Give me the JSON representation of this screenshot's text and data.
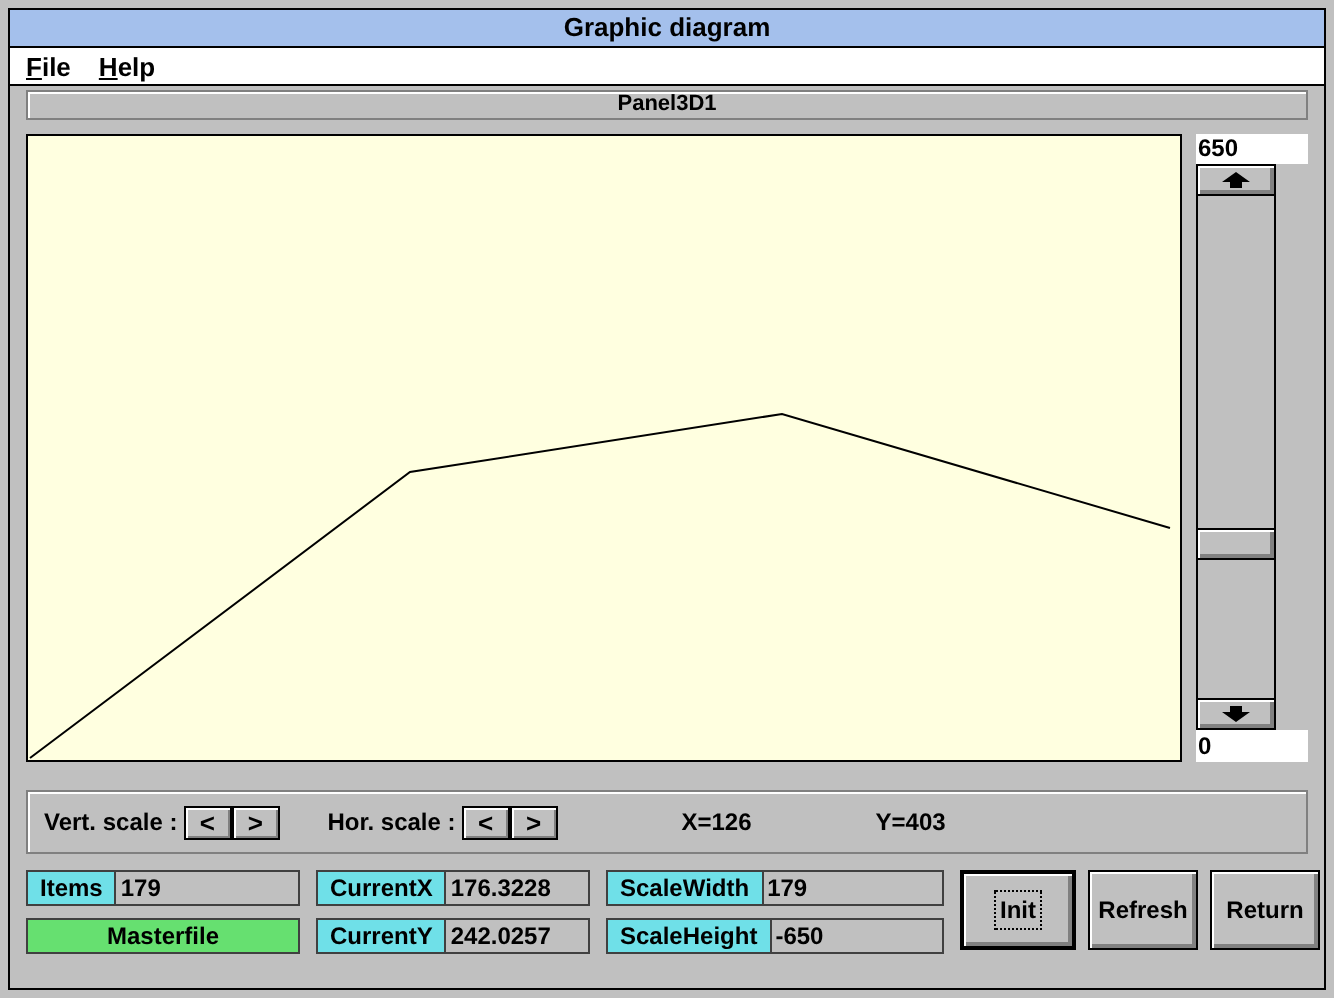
{
  "window": {
    "title": "Graphic diagram"
  },
  "menu": [
    {
      "label": "File"
    },
    {
      "label": "Help"
    }
  ],
  "panel": {
    "title": "Panel3D1"
  },
  "scale": {
    "max": "650",
    "min": "0"
  },
  "toolbar": {
    "vert_label": "Vert. scale :",
    "vert_buttons": [
      "<",
      ">"
    ],
    "hor_label": "Hor. scale :",
    "hor_buttons": [
      "<",
      ">"
    ],
    "x_readout": "X=126",
    "y_readout": "Y=403"
  },
  "fields": [
    {
      "kind": "pair",
      "label": "Items",
      "value": "179"
    },
    {
      "kind": "pair",
      "label": "CurrentX",
      "value": "176.3228"
    },
    {
      "kind": "pair",
      "label": "ScaleWidth",
      "value": "179"
    },
    {
      "kind": "banner",
      "label": "Masterfile"
    },
    {
      "kind": "pair",
      "label": "CurrentY",
      "value": "242.0257"
    },
    {
      "kind": "pair",
      "label": "ScaleHeight",
      "value": "-650"
    }
  ],
  "buttons": [
    {
      "label": "Init",
      "default": true
    },
    {
      "label": "Refresh",
      "default": false
    },
    {
      "label": "Return",
      "default": false
    }
  ]
}
